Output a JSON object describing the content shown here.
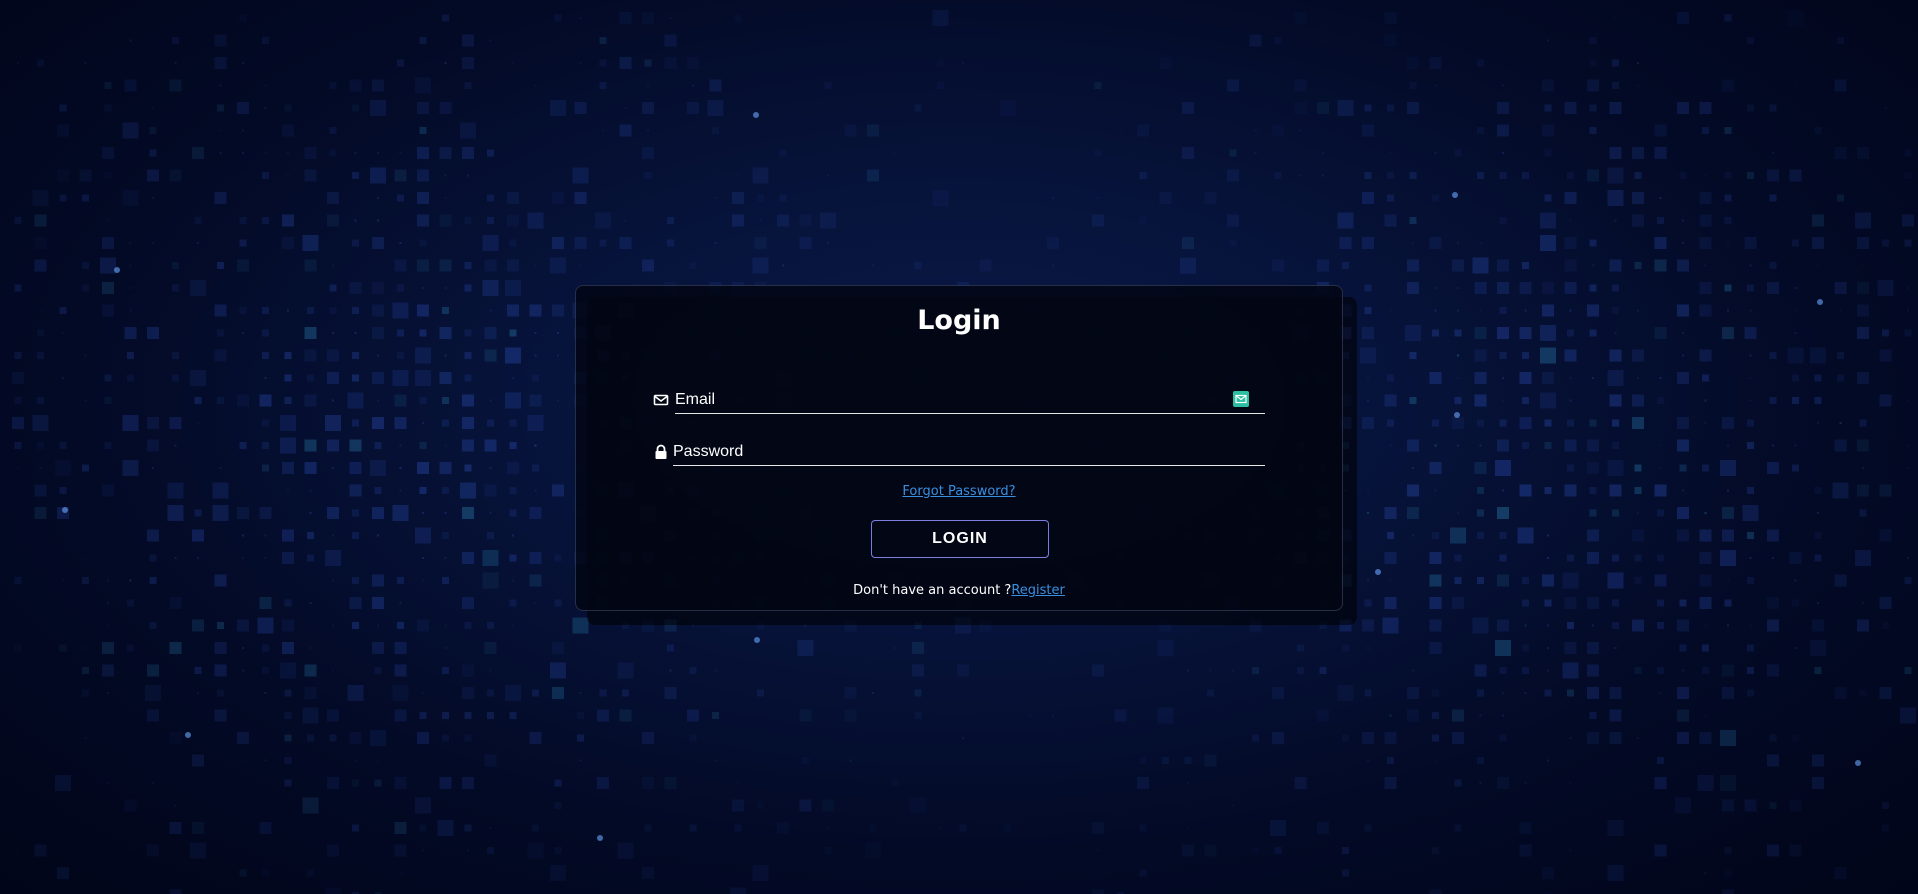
{
  "login_form": {
    "title": "Login",
    "email": {
      "placeholder": "Email",
      "value": "",
      "icon": "envelope-icon"
    },
    "password": {
      "placeholder": "Password",
      "value": "",
      "icon": "lock-icon"
    },
    "forgot_password_link": "Forgot Password?",
    "login_button": "LOGIN",
    "register_prompt": "Don't have an account ?",
    "register_link": "Register"
  },
  "colors": {
    "background": "#030a26",
    "card_background": "#020614",
    "link": "#3a8fe0",
    "button_border": "#7d7fe0",
    "autofill_badge": "#2bbfa3",
    "text": "#ffffff"
  }
}
